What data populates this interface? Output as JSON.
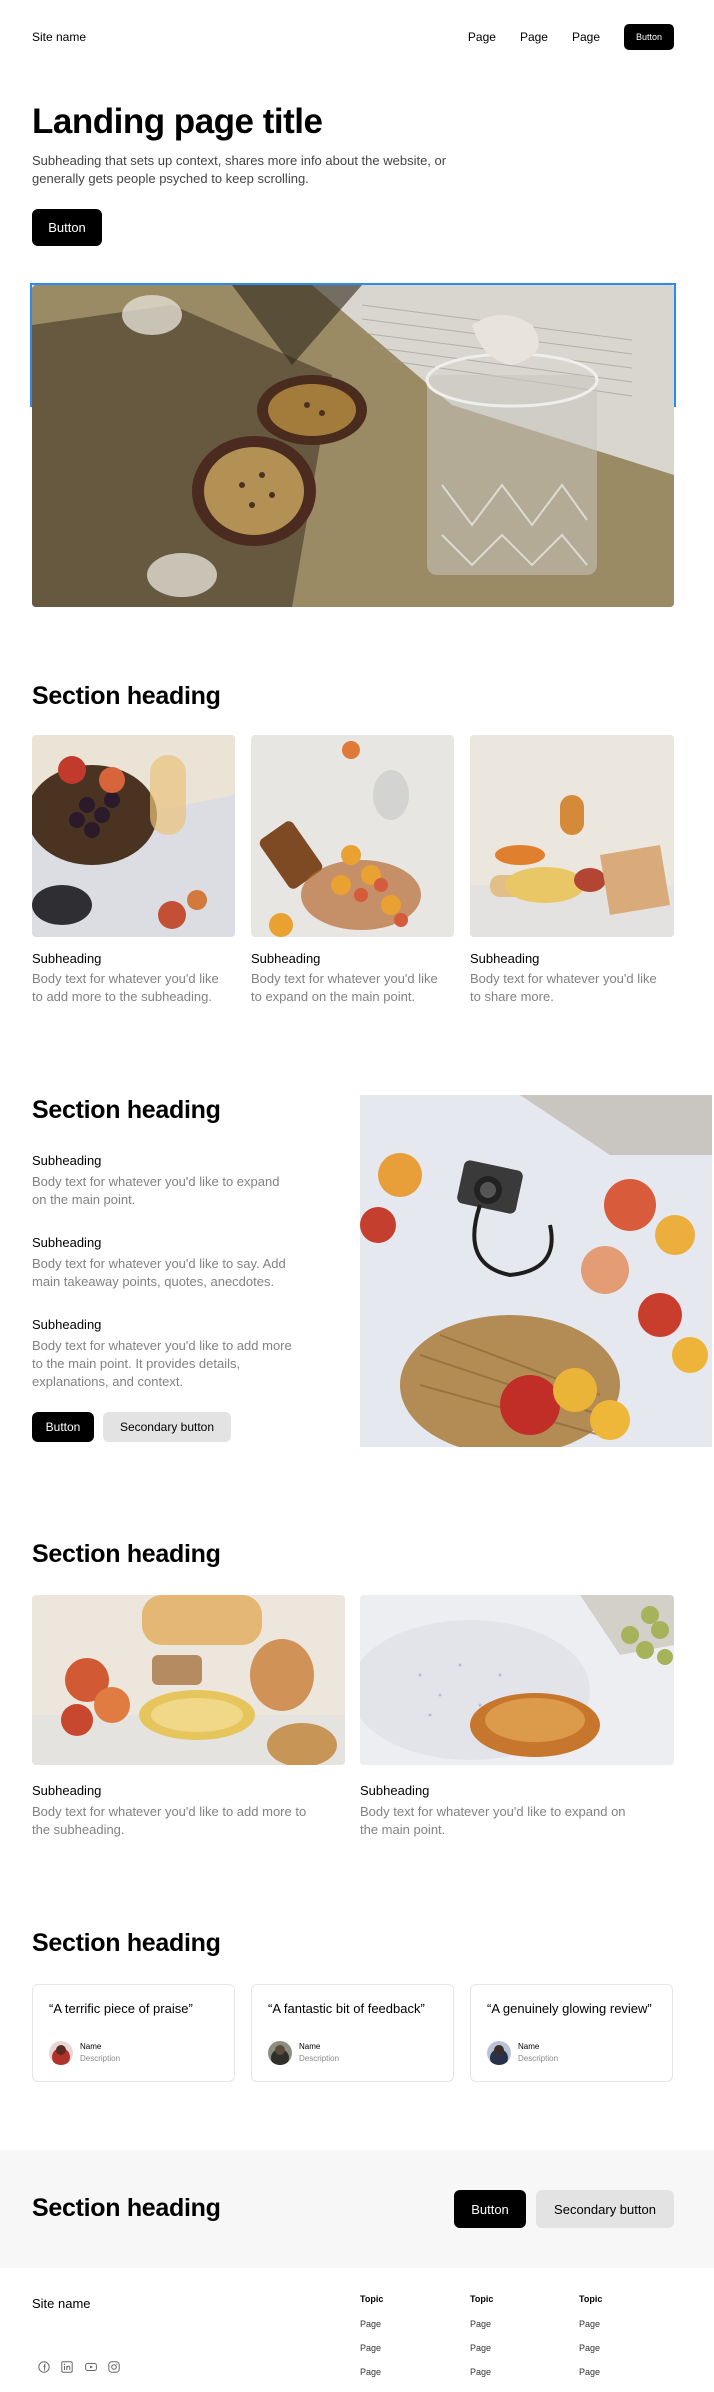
{
  "nav": {
    "site_name": "Site name",
    "links": [
      "Page",
      "Page",
      "Page"
    ],
    "button": "Button"
  },
  "hero": {
    "title": "Landing page title",
    "subheading": "Subheading that sets up context, shares more info about the website, or generally gets people psyched to keep scrolling.",
    "button": "Button"
  },
  "section1": {
    "heading": "Section heading",
    "items": [
      {
        "sub": "Subheading",
        "body": "Body text for whatever you'd like to add more to the subheading."
      },
      {
        "sub": "Subheading",
        "body": "Body text for whatever you'd like to expand on the main point."
      },
      {
        "sub": "Subheading",
        "body": "Body text for whatever you'd like to share more."
      }
    ]
  },
  "section2": {
    "heading": "Section heading",
    "items": [
      {
        "sub": "Subheading",
        "body": "Body text for whatever you'd like to expand on the main point."
      },
      {
        "sub": "Subheading",
        "body": "Body text for whatever you'd like to say. Add main takeaway points, quotes, anecdotes."
      },
      {
        "sub": "Subheading",
        "body": "Body text for whatever you'd like to add more to the main point. It provides details, explanations, and context."
      }
    ],
    "button": "Button",
    "secondary_button": "Secondary button"
  },
  "section3": {
    "heading": "Section heading",
    "items": [
      {
        "sub": "Subheading",
        "body": "Body text for whatever you'd like to add more to the subheading."
      },
      {
        "sub": "Subheading",
        "body": "Body text for whatever you'd like to expand on the main point."
      }
    ]
  },
  "testimonials": {
    "heading": "Section heading",
    "cards": [
      {
        "quote": "“A terrific piece of praise”",
        "name": "Name",
        "description": "Description"
      },
      {
        "quote": "“A fantastic bit of feedback”",
        "name": "Name",
        "description": "Description"
      },
      {
        "quote": "“A genuinely glowing review”",
        "name": "Name",
        "description": "Description"
      }
    ]
  },
  "cta": {
    "heading": "Section heading",
    "button": "Button",
    "secondary_button": "Secondary button"
  },
  "footer": {
    "site_name": "Site name",
    "social_icons": [
      "facebook-icon",
      "linkedin-icon",
      "youtube-icon",
      "instagram-icon"
    ],
    "columns": [
      {
        "topic": "Topic",
        "pages": [
          "Page",
          "Page",
          "Page"
        ]
      },
      {
        "topic": "Topic",
        "pages": [
          "Page",
          "Page",
          "Page"
        ]
      },
      {
        "topic": "Topic",
        "pages": [
          "Page",
          "Page",
          "Page"
        ]
      }
    ]
  },
  "colors": {
    "accent_selection": "#2a8bf2",
    "button_primary": "#000000",
    "button_secondary": "#e3e3e3",
    "body_text": "#828282",
    "cta_background": "#f7f7f7"
  }
}
